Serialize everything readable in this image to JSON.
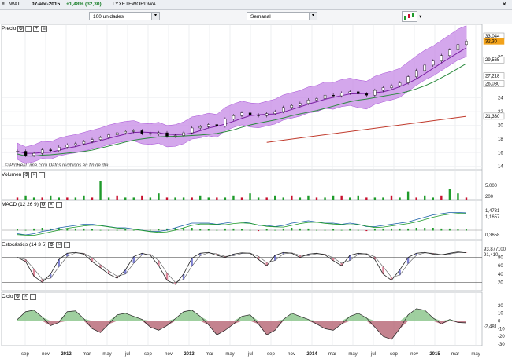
{
  "window": {
    "title": "WAT",
    "date": "07-abr-2015",
    "change": "+1,48% (32,30)",
    "symbol": "LYXETFWORDWA"
  },
  "toolbar": {
    "units": "100 unidades",
    "period": "Semanal"
  },
  "panels": {
    "price": {
      "label": "Precio",
      "credit": "© ProRealTime.com  Datos recibidos en fin de dia"
    },
    "volume": {
      "label": "Volumen"
    },
    "macd": {
      "label": "MACD (12 26 9)"
    },
    "stoch": {
      "label": "Estocástico (14 3 5)"
    },
    "cycle": {
      "label": "Ciclo"
    }
  },
  "colors": {
    "band": "#a64dd6",
    "band_fill": "#c58ae6",
    "up_bar": "#1f9b2b",
    "down_bar": "#c8102e",
    "ma_short": "#7a1fa2",
    "ma_mid": "#2b8a3e",
    "trend": "#c0392b",
    "last_price": "#f2a21a"
  },
  "chart_data": [
    {
      "type": "line",
      "name": "price",
      "x_ticks": [
        "sep",
        "nov",
        "2012",
        "mar",
        "may",
        "jul",
        "sep",
        "nov",
        "2013",
        "mar",
        "may",
        "jul",
        "sep",
        "nov",
        "2014",
        "mar",
        "may",
        "jul",
        "sep",
        "nov",
        "2015",
        "mar",
        "may"
      ],
      "y_ticks": [
        14,
        16,
        18,
        20,
        22,
        24,
        30
      ],
      "ylim": [
        13.5,
        33.5
      ],
      "markers": [
        {
          "label": "33,044",
          "value": 33.04
        },
        {
          "label": "32,30",
          "value": 32.3
        },
        {
          "label": "29,565",
          "value": 29.565
        },
        {
          "label": "27,218",
          "value": 27.218
        },
        {
          "label": "26,080",
          "value": 26.08
        },
        {
          "label": "21,330",
          "value": 21.33
        }
      ],
      "series": [
        {
          "values": [
            16.2,
            15.6,
            15.9,
            16.4,
            16.3,
            16.8,
            17.1,
            17.3,
            17.6,
            17.9,
            18.2,
            18.6,
            18.9,
            19.1,
            19.2,
            18.8,
            18.7,
            18.9,
            18.4,
            18.5,
            18.9,
            19.6,
            19.8,
            20.1,
            19.9,
            20.9,
            21.4,
            21.8,
            21.5,
            21.4,
            21.7,
            22.0,
            22.6,
            22.9,
            23.2,
            23.7,
            23.9,
            24.4,
            24.3,
            24.7,
            24.9,
            24.6,
            24.4,
            25.1,
            25.5,
            25.8,
            26.2,
            27.1,
            28.0,
            28.8,
            29.4,
            30.2,
            31.0,
            31.8,
            32.3
          ]
        }
      ]
    },
    {
      "type": "bar",
      "name": "volume",
      "y_ticks": [
        "5.000",
        "200"
      ],
      "values": [
        1,
        2,
        1,
        1,
        2,
        1,
        1,
        1,
        2,
        1,
        9,
        1,
        2,
        1,
        1,
        2,
        1,
        3,
        1,
        1,
        1,
        1,
        2,
        1,
        1,
        1,
        2,
        1,
        3,
        1,
        1,
        2,
        1,
        2,
        1,
        2,
        1,
        1,
        2,
        2,
        1,
        2,
        1,
        1,
        1,
        2,
        1,
        4,
        1,
        2,
        1,
        2,
        5,
        3,
        1
      ],
      "ylim": [
        0,
        10
      ]
    },
    {
      "type": "line",
      "name": "macd",
      "markers": [
        {
          "label": "1,4731"
        },
        {
          "label": "1,1657"
        },
        {
          "label": "0,3658"
        }
      ],
      "values": [
        -0.3,
        -0.4,
        -0.3,
        -0.1,
        0.0,
        0.2,
        0.3,
        0.4,
        0.5,
        0.5,
        0.4,
        0.3,
        0.2,
        0.2,
        0.1,
        0.0,
        -0.1,
        -0.1,
        0.0,
        0.2,
        0.4,
        0.6,
        0.6,
        0.6,
        0.5,
        0.6,
        0.7,
        0.7,
        0.6,
        0.4,
        0.4,
        0.3,
        0.4,
        0.6,
        0.7,
        0.8,
        0.7,
        0.6,
        0.6,
        0.5,
        0.6,
        0.5,
        0.3,
        0.3,
        0.4,
        0.5,
        0.6,
        0.7,
        0.9,
        1.1,
        1.3,
        1.4,
        1.5,
        1.5,
        1.47
      ],
      "ylim": [
        -0.8,
        1.8
      ]
    },
    {
      "type": "line",
      "name": "stochastic",
      "y_ticks": [
        100,
        80,
        60,
        40,
        20
      ],
      "markers": [
        {
          "label": "93,877"
        },
        {
          "label": "91,410"
        }
      ],
      "values": [
        80,
        70,
        35,
        20,
        40,
        75,
        90,
        92,
        88,
        70,
        55,
        40,
        30,
        50,
        82,
        90,
        85,
        60,
        25,
        15,
        40,
        78,
        90,
        92,
        85,
        80,
        88,
        91,
        90,
        75,
        60,
        85,
        92,
        90,
        80,
        88,
        90,
        86,
        72,
        60,
        85,
        90,
        88,
        75,
        40,
        25,
        50,
        80,
        90,
        92,
        88,
        86,
        90,
        93,
        91
      ],
      "ylim": [
        0,
        100
      ]
    },
    {
      "type": "area",
      "name": "cycle",
      "y_ticks": [
        20,
        10,
        0,
        -10,
        -20,
        -30
      ],
      "markers": [
        {
          "label": "-2,481"
        }
      ],
      "values": [
        2,
        12,
        14,
        5,
        -6,
        -2,
        12,
        13,
        3,
        -10,
        -15,
        -4,
        8,
        10,
        6,
        2,
        -8,
        -12,
        -6,
        3,
        12,
        14,
        6,
        -5,
        -18,
        -12,
        -4,
        6,
        8,
        -4,
        -18,
        -12,
        2,
        10,
        6,
        2,
        -4,
        -10,
        -12,
        -4,
        6,
        10,
        4,
        -8,
        -20,
        -24,
        -10,
        8,
        16,
        14,
        4,
        -4,
        2,
        -2,
        -2.5
      ],
      "ylim": [
        -32,
        26
      ]
    }
  ]
}
